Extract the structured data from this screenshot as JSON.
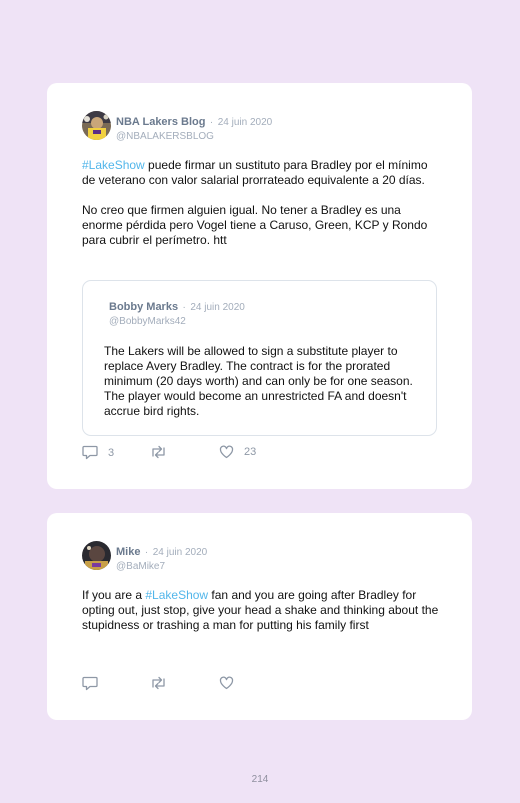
{
  "tweets": [
    {
      "name": "NBA Lakers Blog",
      "date": "24 juin 2020",
      "handle": "@NBALAKERSBLOG",
      "hashtag": "#LakeShow",
      "text_after_hashtag": " puede firmar un sustituto para Bradley por el mínimo de veterano con valor salarial prorrateado equivalente a 20 días.",
      "paragraph2": "No creo que firmen alguien igual. No tener a Bradley es una enorme pérdida pero Vogel tiene a Caruso, Green, KCP y Rondo para cubrir el perímetro. htt",
      "quote": {
        "name": "Bobby Marks",
        "date": "24 juin 2020",
        "handle": "@BobbyMarks42",
        "text": "The Lakers will be allowed to sign a substitute player to replace Avery Bradley. The contract is for the prorated minimum (20 days worth) and can only be for one season. The player would become an unrestricted FA and doesn't accrue bird rights."
      },
      "replies": "3",
      "retweets": "",
      "likes": "23",
      "icons": [
        "reply-icon",
        "retweet-icon",
        "heart-icon"
      ]
    },
    {
      "name": "Mike",
      "date": "24 juin 2020",
      "handle": "@BaMike7",
      "text_before_hashtag": "If you are a ",
      "hashtag": "#LakeShow",
      "text_after_hashtag": " fan and you are going after Bradley for opting out, just stop, give your head a shake and thinking about the stupidness or trashing a man for putting his family first",
      "replies": "",
      "retweets": "",
      "likes": "",
      "icons": [
        "reply-icon",
        "retweet-icon",
        "heart-icon"
      ]
    }
  ],
  "separator": "·",
  "page_number": "214",
  "colors": {
    "background": "#efe3f6",
    "hashtag": "#52b6ea",
    "name": "#6b7a8e",
    "muted": "#a3adbb"
  }
}
